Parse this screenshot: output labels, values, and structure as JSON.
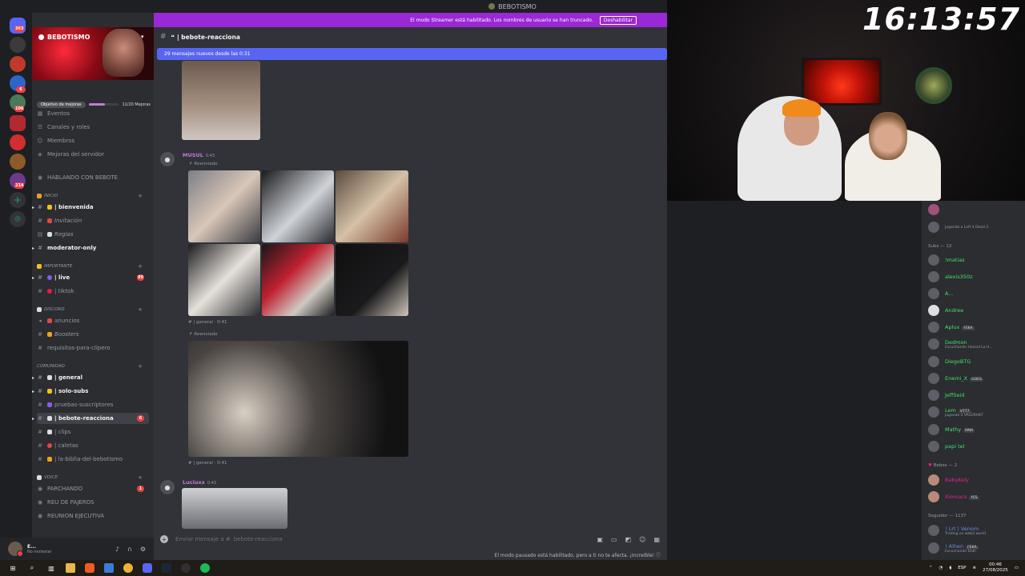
{
  "window": {
    "title": "BEBOTISMO"
  },
  "rail": {
    "badges": [
      "363",
      "",
      "",
      "6",
      "106",
      "",
      "",
      "214"
    ]
  },
  "server": {
    "name": "BEBOTISMO",
    "boost_goal": "Objetivo de mejoras",
    "boost_count": "11/20 Mejoras",
    "boost_progress": 0.55
  },
  "menu": {
    "events": "Eventos",
    "channels_roles": "Canales y roles",
    "members": "Miembros",
    "boosts": "Mejoras del servidor",
    "speaking": "HABLANDO CON BEBOTE"
  },
  "categories": {
    "inicio": "INICIO",
    "importante": "IMPORTANTE",
    "discord": "DISCORD",
    "comunidad": "COMUNIDAD",
    "voice": "VOICE"
  },
  "channels": {
    "bienvenida": "| bienvenida",
    "invitacion": "Invitación",
    "reglas": "Reglas",
    "moderator": "moderator-only",
    "live": "| live",
    "live_badge": "99",
    "tiktok": "| tiktok",
    "anuncios": "anuncios",
    "boosters": "Boosters",
    "requisitos": "requisitos-para-clipero",
    "general": "| general",
    "solo_subs": "| solo-subs",
    "pruebas": "pruebas-suscriptores",
    "bebote": "| bebote-reacciona",
    "bebote_badge": "6",
    "clips": "| clips",
    "caletas": "| caletas",
    "biblia": "| la-biblia-del-bebotismo",
    "parchando": "PARCHANDO",
    "parchando_badge": "1",
    "reu": "REU DE PAJEROS",
    "reunion": "REUNION EJECUTIVA"
  },
  "user": {
    "name": "E...",
    "status": "No molestar"
  },
  "header": {
    "streamer_notice": "El modo Streamer está habilitado. Los nombres de usuario se han truncado.",
    "disable_button": "Deshabilitar",
    "channel": "| bebote-reacciona",
    "new_messages": "29 mensajes nuevos desde las 0:31"
  },
  "messages": [
    {
      "author": "MUSUL",
      "time": "0:43",
      "forwarded": "Reenviado",
      "source": "| general · 0:41",
      "color": "#c37bd9"
    },
    {
      "author": "",
      "time": "",
      "forwarded": "Reenviado",
      "source": "| general · 0:41",
      "color": "#c37bd9"
    },
    {
      "author": "Luciuxx",
      "time": "0:43",
      "forwarded": "",
      "source": "",
      "color": "#c37bd9"
    }
  ],
  "composer": {
    "placeholder": "Enviar mensaje a #",
    "channel": "bebote-reacciona",
    "paused_note": "El modo pausado está habilitado, pero a ti no te afecta. ¡Increíble!"
  },
  "stream": {
    "clock": "16:13:57"
  },
  "member_groups": {
    "subs": "Subs — 12",
    "bebes": "Bebes — 2",
    "seguidor": "Seguidor — 1137"
  },
  "members": [
    {
      "name": "!matias",
      "color": "#43e06b",
      "activity": "",
      "tag": ""
    },
    {
      "name": "alexis350z",
      "color": "#43e06b",
      "activity": "",
      "tag": ""
    },
    {
      "name": "A...",
      "color": "#43e06b",
      "activity": "",
      "tag": ""
    },
    {
      "name": "Andree",
      "color": "#43e06b",
      "activity": "",
      "tag": ""
    },
    {
      "name": "Aplux",
      "color": "#43e06b",
      "activity": "",
      "tag": "FEKA"
    },
    {
      "name": "Dedmon",
      "color": "#43e06b",
      "activity": "Escuchando Hansel La H...",
      "tag": ""
    },
    {
      "name": "DiegoBTG",
      "color": "#43e06b",
      "activity": "",
      "tag": ""
    },
    {
      "name": "Enemi_X",
      "color": "#43e06b",
      "activity": "",
      "tag": "GOES"
    },
    {
      "name": "JeffSeid",
      "color": "#43e06b",
      "activity": "",
      "tag": ""
    },
    {
      "name": "Lem",
      "color": "#43e06b",
      "activity": "Jugando a VALORANT",
      "tag": "V777"
    },
    {
      "name": "Mathy",
      "color": "#43e06b",
      "activity": "",
      "tag": "RMA"
    },
    {
      "name": "papi tel",
      "color": "#43e06b",
      "activity": "",
      "tag": ""
    },
    {
      "name": "BabyKely",
      "color": "#e91e8c",
      "activity": "",
      "tag": ""
    },
    {
      "name": "Xiomara",
      "color": "#e91e8c",
      "activity": "",
      "tag": "YES"
    },
    {
      "name": "! Lrt | Venom",
      "color": "#7289da",
      "activity": "Trading on web3.world",
      "tag": ""
    },
    {
      "name": "! Alhen",
      "color": "#7289da",
      "activity": "Escuchando Duki",
      "tag": "FEKA"
    }
  ],
  "top_members": [
    {
      "activity": ""
    },
    {
      "activity": "Jugando a Left 4 Dead 2"
    }
  ],
  "taskbar": {
    "lang": "ESP",
    "time": "00:46",
    "date": "27/08/2025"
  },
  "colors": {
    "streamer_bar": "#9b28d6",
    "new_messages": "#5865f2",
    "sidebar": "#2b2d31",
    "chat": "#313338",
    "subs": "#43e06b",
    "bebes": "#e91e8c"
  }
}
